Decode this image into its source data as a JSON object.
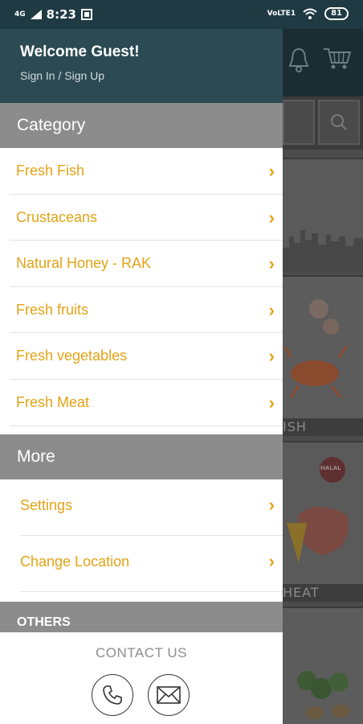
{
  "status_bar": {
    "network_left": "4G",
    "time": "8:23",
    "network_right": "VoLTE1"
  },
  "battery": "81",
  "drawer": {
    "welcome": "Welcome Guest!",
    "signin": "Sign In / Sign Up",
    "category_title": "Category",
    "categories": [
      {
        "label": "Fresh Fish"
      },
      {
        "label": "Crustaceans"
      },
      {
        "label": "Natural Honey - RAK"
      },
      {
        "label": "Fresh fruits"
      },
      {
        "label": "Fresh vegetables"
      },
      {
        "label": "Fresh Meat"
      }
    ],
    "more_title": "More",
    "more_items": [
      {
        "label": "Settings"
      },
      {
        "label": "Change Location"
      }
    ],
    "others_title": "OTHERS"
  },
  "contact": {
    "title": "CONTACT US"
  },
  "background": {
    "tiles": [
      {
        "label": "ISH"
      },
      {
        "label": "HEAT"
      }
    ],
    "halal_label": "HALAL"
  },
  "colors": {
    "accent": "#e3a317",
    "header": "#2b4a53",
    "section": "#8c8c8c"
  }
}
